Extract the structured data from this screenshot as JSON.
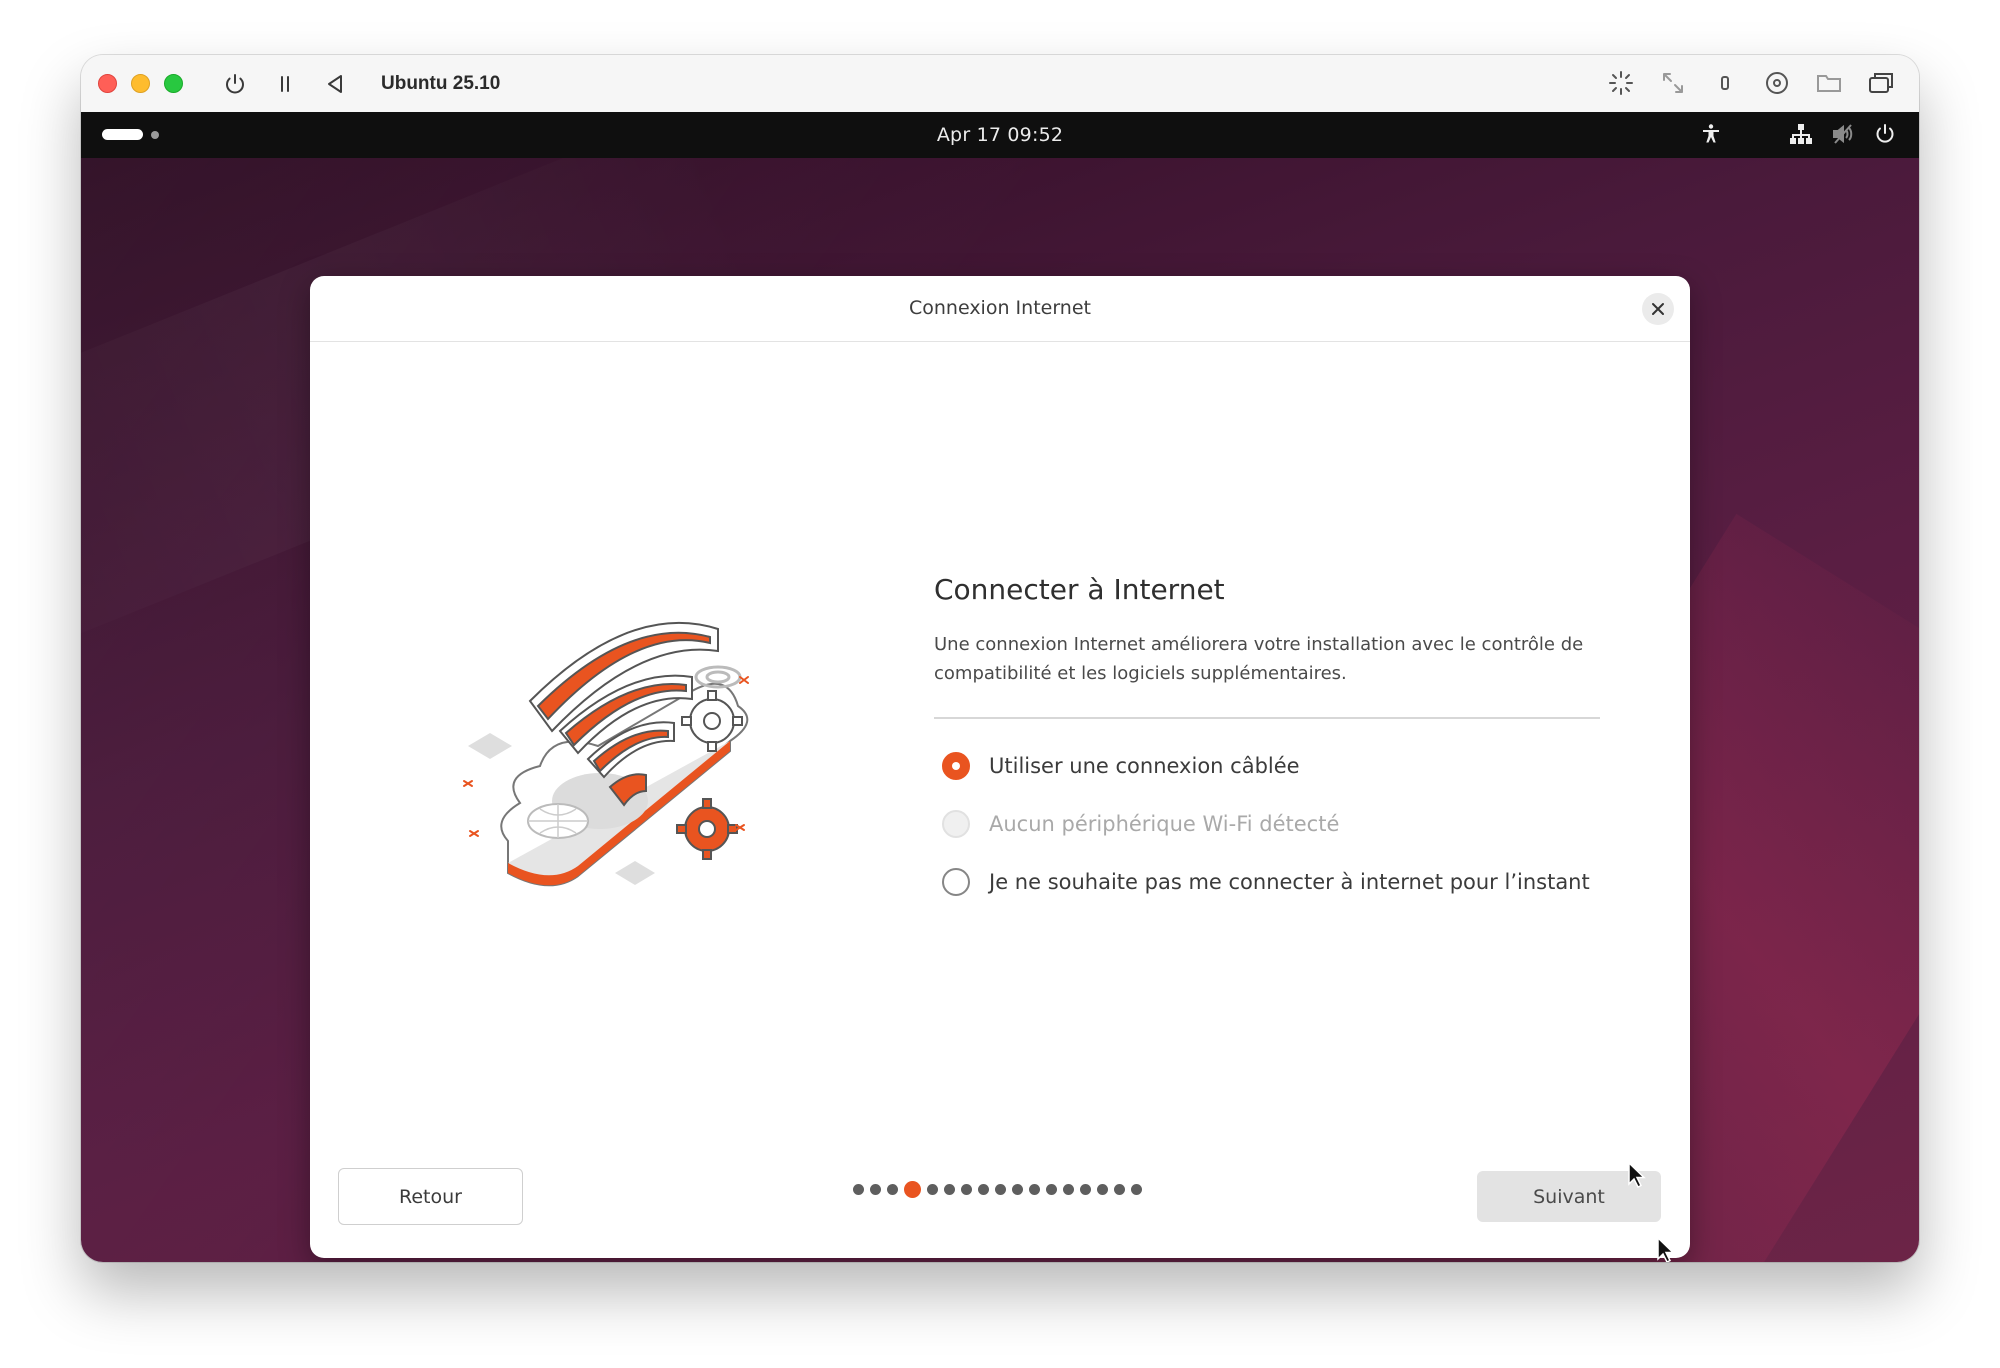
{
  "vm_window": {
    "title": "Ubuntu 25.10",
    "controls": [
      "power-icon",
      "pause-icon",
      "back-icon"
    ],
    "right_tools": [
      "capture-cursor-icon",
      "resize-icon",
      "usb-icon",
      "disc-icon",
      "shared-folder-icon",
      "windows-icon"
    ]
  },
  "topbar": {
    "clock": "Apr 17  09:52",
    "tray_icons": [
      "accessibility-icon",
      "network-wired-icon",
      "volume-muted-icon",
      "power-icon"
    ]
  },
  "dialog": {
    "title": "Connexion Internet",
    "heading": "Connecter à Internet",
    "description": "Une connexion Internet améliorera votre installation avec le contrôle de compatibilité et les logiciels supplémentaires.",
    "options": [
      {
        "label": "Utiliser une connexion câblée",
        "checked": true,
        "disabled": false
      },
      {
        "label": "Aucun périphérique Wi-Fi détecté",
        "checked": false,
        "disabled": true
      },
      {
        "label": "Je ne souhaite pas me connecter à internet pour l’instant",
        "checked": false,
        "disabled": false
      }
    ],
    "back_label": "Retour",
    "next_label": "Suivant",
    "pager": {
      "total": 17,
      "current": 4
    }
  },
  "colors": {
    "accent": "#e95420",
    "topbar": "#0f0f0f",
    "desktop": "#4a1a3b"
  }
}
